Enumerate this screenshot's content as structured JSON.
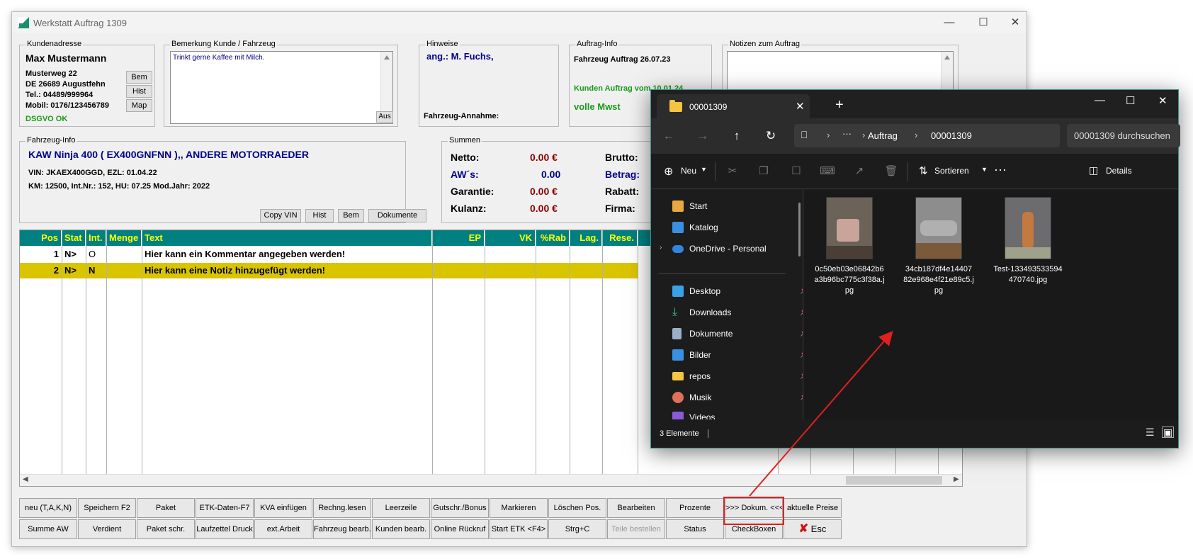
{
  "main": {
    "title": "Werkstatt Auftrag 1309",
    "kundenadresse": {
      "label": "Kundenadresse",
      "name": "Max Mustermann",
      "street": "Musterweg 22",
      "city": "DE 26689 Augustfehn",
      "tel": "Tel.: 04489/999964",
      "mobil": "Mobil: 0176/123456789",
      "dsgvo": "DSGVO OK",
      "buttons": [
        "Bem",
        "Hist",
        "Map"
      ]
    },
    "bemerkung": {
      "label": "Bemerkung Kunde / Fahrzeug",
      "text": "Trinkt gerne Kaffee mit Milch.",
      "aus_button": "Aus"
    },
    "hinweise": {
      "label": "Hinweise",
      "text": "ang.: M. Fuchs,",
      "annahme": "Fahrzeug-Annahme:"
    },
    "auftrag_info": {
      "label": "Auftrag-Info",
      "fahrzeug": "Fahrzeug Auftrag 26.07.23",
      "kunden": "Kunden Auftrag vom 10.01.24",
      "mwst": "volle Mwst"
    },
    "notizen": {
      "label": "Notizen zum Auftrag"
    },
    "fahrzeug_info": {
      "label": "Fahrzeug-Info",
      "model": "KAW Ninja 400 ( EX400GNFNN ),, ANDERE MOTORRAEDER",
      "vin": "VIN: JKAEX400GGD, EZL: 01.04.22",
      "km": "KM: 12500, Int.Nr.: 152, HU: 07.25 Mod.Jahr: 2022",
      "buttons": [
        "Copy VIN",
        "Hist",
        "Bem",
        "Dokumente"
      ]
    },
    "summen": {
      "label": "Summen",
      "rows": [
        {
          "label": "Netto:",
          "value": "0.00 €"
        },
        {
          "label": "AW´s:",
          "value": "0.00"
        },
        {
          "label": "Garantie:",
          "value": "0.00 €"
        },
        {
          "label": "Kulanz:",
          "value": "0.00 €"
        }
      ],
      "right_labels": [
        "Brutto:",
        "Betrag:",
        "Rabatt:",
        "Firma:"
      ]
    },
    "grid": {
      "headers": [
        "Pos",
        "Stat",
        "Int.",
        "Menge",
        "Text",
        "EP",
        "VK",
        "%Rab",
        "Lag.",
        "Rese."
      ],
      "rows": [
        {
          "pos": "1",
          "stat": "N>",
          "int": "O",
          "menge": "",
          "text": "Hier kann ein Kommentar angegeben werden!"
        },
        {
          "pos": "2",
          "stat": "N>",
          "int": "N",
          "menge": "",
          "text": "Hier kann eine Notiz hinzugefügt werden!"
        }
      ]
    },
    "buttons_row1": [
      "neu (T,A,K,N)",
      "Speichern F2",
      "Paket",
      "ETK-Daten-F7",
      "KVA einfügen",
      "Rechng.lesen",
      "Leerzeile",
      "Gutschr./Bonus",
      "Markieren",
      "Löschen Pos.",
      "Bearbeiten",
      "Prozente",
      ">>> Dokum. <<<",
      "aktuelle Preise"
    ],
    "buttons_row2": [
      "Summe AW",
      "Verdient",
      "Paket schr.",
      "Laufzettel Druck",
      "ext.Arbeit",
      "Fahrzeug bearb.",
      "Kunden bearb.",
      "Online Rückruf",
      "Start ETK <F4>",
      "Strg+C",
      "Teile bestellen",
      "Status",
      "CheckBoxen",
      "Esc"
    ],
    "colors": {
      "grid_header_bg": "#008080",
      "grid_header_fg": "#ffff00",
      "selected_row": "#d9c400",
      "name_blue": "#00008b",
      "green": "#1a9a1a",
      "red_value": "#8b0000",
      "highlight": "#e02020"
    }
  },
  "explorer": {
    "tab_title": "00001309",
    "breadcrumb": [
      "Auftrag",
      "00001309"
    ],
    "search_placeholder": "00001309 durchsuchen",
    "cmd": {
      "new": "Neu",
      "sort": "Sortieren",
      "details": "Details"
    },
    "nav": [
      {
        "label": "Start",
        "icon": "home-icon",
        "pinned": false
      },
      {
        "label": "Katalog",
        "icon": "gallery-icon",
        "pinned": false
      },
      {
        "label": "OneDrive - Personal",
        "icon": "cloud-icon",
        "pinned": false
      },
      {
        "label": "Desktop",
        "icon": "desktop-icon",
        "pinned": true
      },
      {
        "label": "Downloads",
        "icon": "download-icon",
        "pinned": true
      },
      {
        "label": "Dokumente",
        "icon": "document-icon",
        "pinned": true
      },
      {
        "label": "Bilder",
        "icon": "pictures-icon",
        "pinned": true
      },
      {
        "label": "repos",
        "icon": "folder-icon",
        "pinned": true
      },
      {
        "label": "Musik",
        "icon": "music-icon",
        "pinned": true
      },
      {
        "label": "Videos",
        "icon": "video-icon",
        "pinned": true
      }
    ],
    "files": [
      {
        "name": "0c50eb03e06842b6a3b96bc775c3f38a.jpg",
        "thumb_colors": [
          "#6b6258",
          "#c9a49a",
          "#4a3e37"
        ]
      },
      {
        "name": "34cb187df4e1440782e968e4f21e89c5.jpg",
        "thumb_colors": [
          "#8d8d8d",
          "#b0b0b0",
          "#7b5a3a"
        ]
      },
      {
        "name": "Test-133493533594470740.jpg",
        "thumb_colors": [
          "#6c6b6e",
          "#c4793f",
          "#9fa18b"
        ]
      }
    ],
    "status": "3 Elemente"
  }
}
